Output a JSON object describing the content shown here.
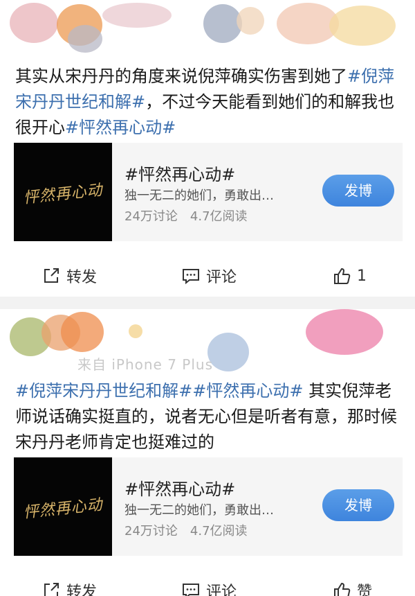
{
  "posts": [
    {
      "header_faint_text": "",
      "text_segments": [
        {
          "t": "其实从宋丹丹的角度来说倪萍确实伤害到她了",
          "tag": false
        },
        {
          "t": "#倪萍宋丹丹世纪和解#",
          "tag": true
        },
        {
          "t": "，不过今天能看到她们的和解我也很开心",
          "tag": false
        },
        {
          "t": "#怦然再心动#",
          "tag": true
        }
      ],
      "card": {
        "thumb_logo": "怦然再心动",
        "title": "#怦然再心动#",
        "desc": "独一无二的她们，勇敢出…",
        "discussions": "24万讨论",
        "reads": "4.7亿阅读",
        "button": "发博"
      },
      "actions": {
        "repost": "转发",
        "comment": "评论",
        "like": "1"
      }
    },
    {
      "header_faint_text": "来自 iPhone 7 Plus",
      "text_segments": [
        {
          "t": "#倪萍宋丹丹世纪和解##怦然再心动#",
          "tag": true
        },
        {
          "t": " 其实倪萍老师说话确实挺直的，说者无心但是听者有意，那时候宋丹丹老师肯定也挺难过的",
          "tag": false
        }
      ],
      "card": {
        "thumb_logo": "怦然再心动",
        "title": "#怦然再心动#",
        "desc": "独一无二的她们，勇敢出…",
        "discussions": "24万讨论",
        "reads": "4.7亿阅读",
        "button": "发博"
      },
      "actions": {
        "repost": "转发",
        "comment": "评论",
        "like": "赞"
      }
    }
  ],
  "colors": {
    "tag": "#3c6fae",
    "button": "#4a8fe3",
    "separator": "#f2f2f2"
  }
}
